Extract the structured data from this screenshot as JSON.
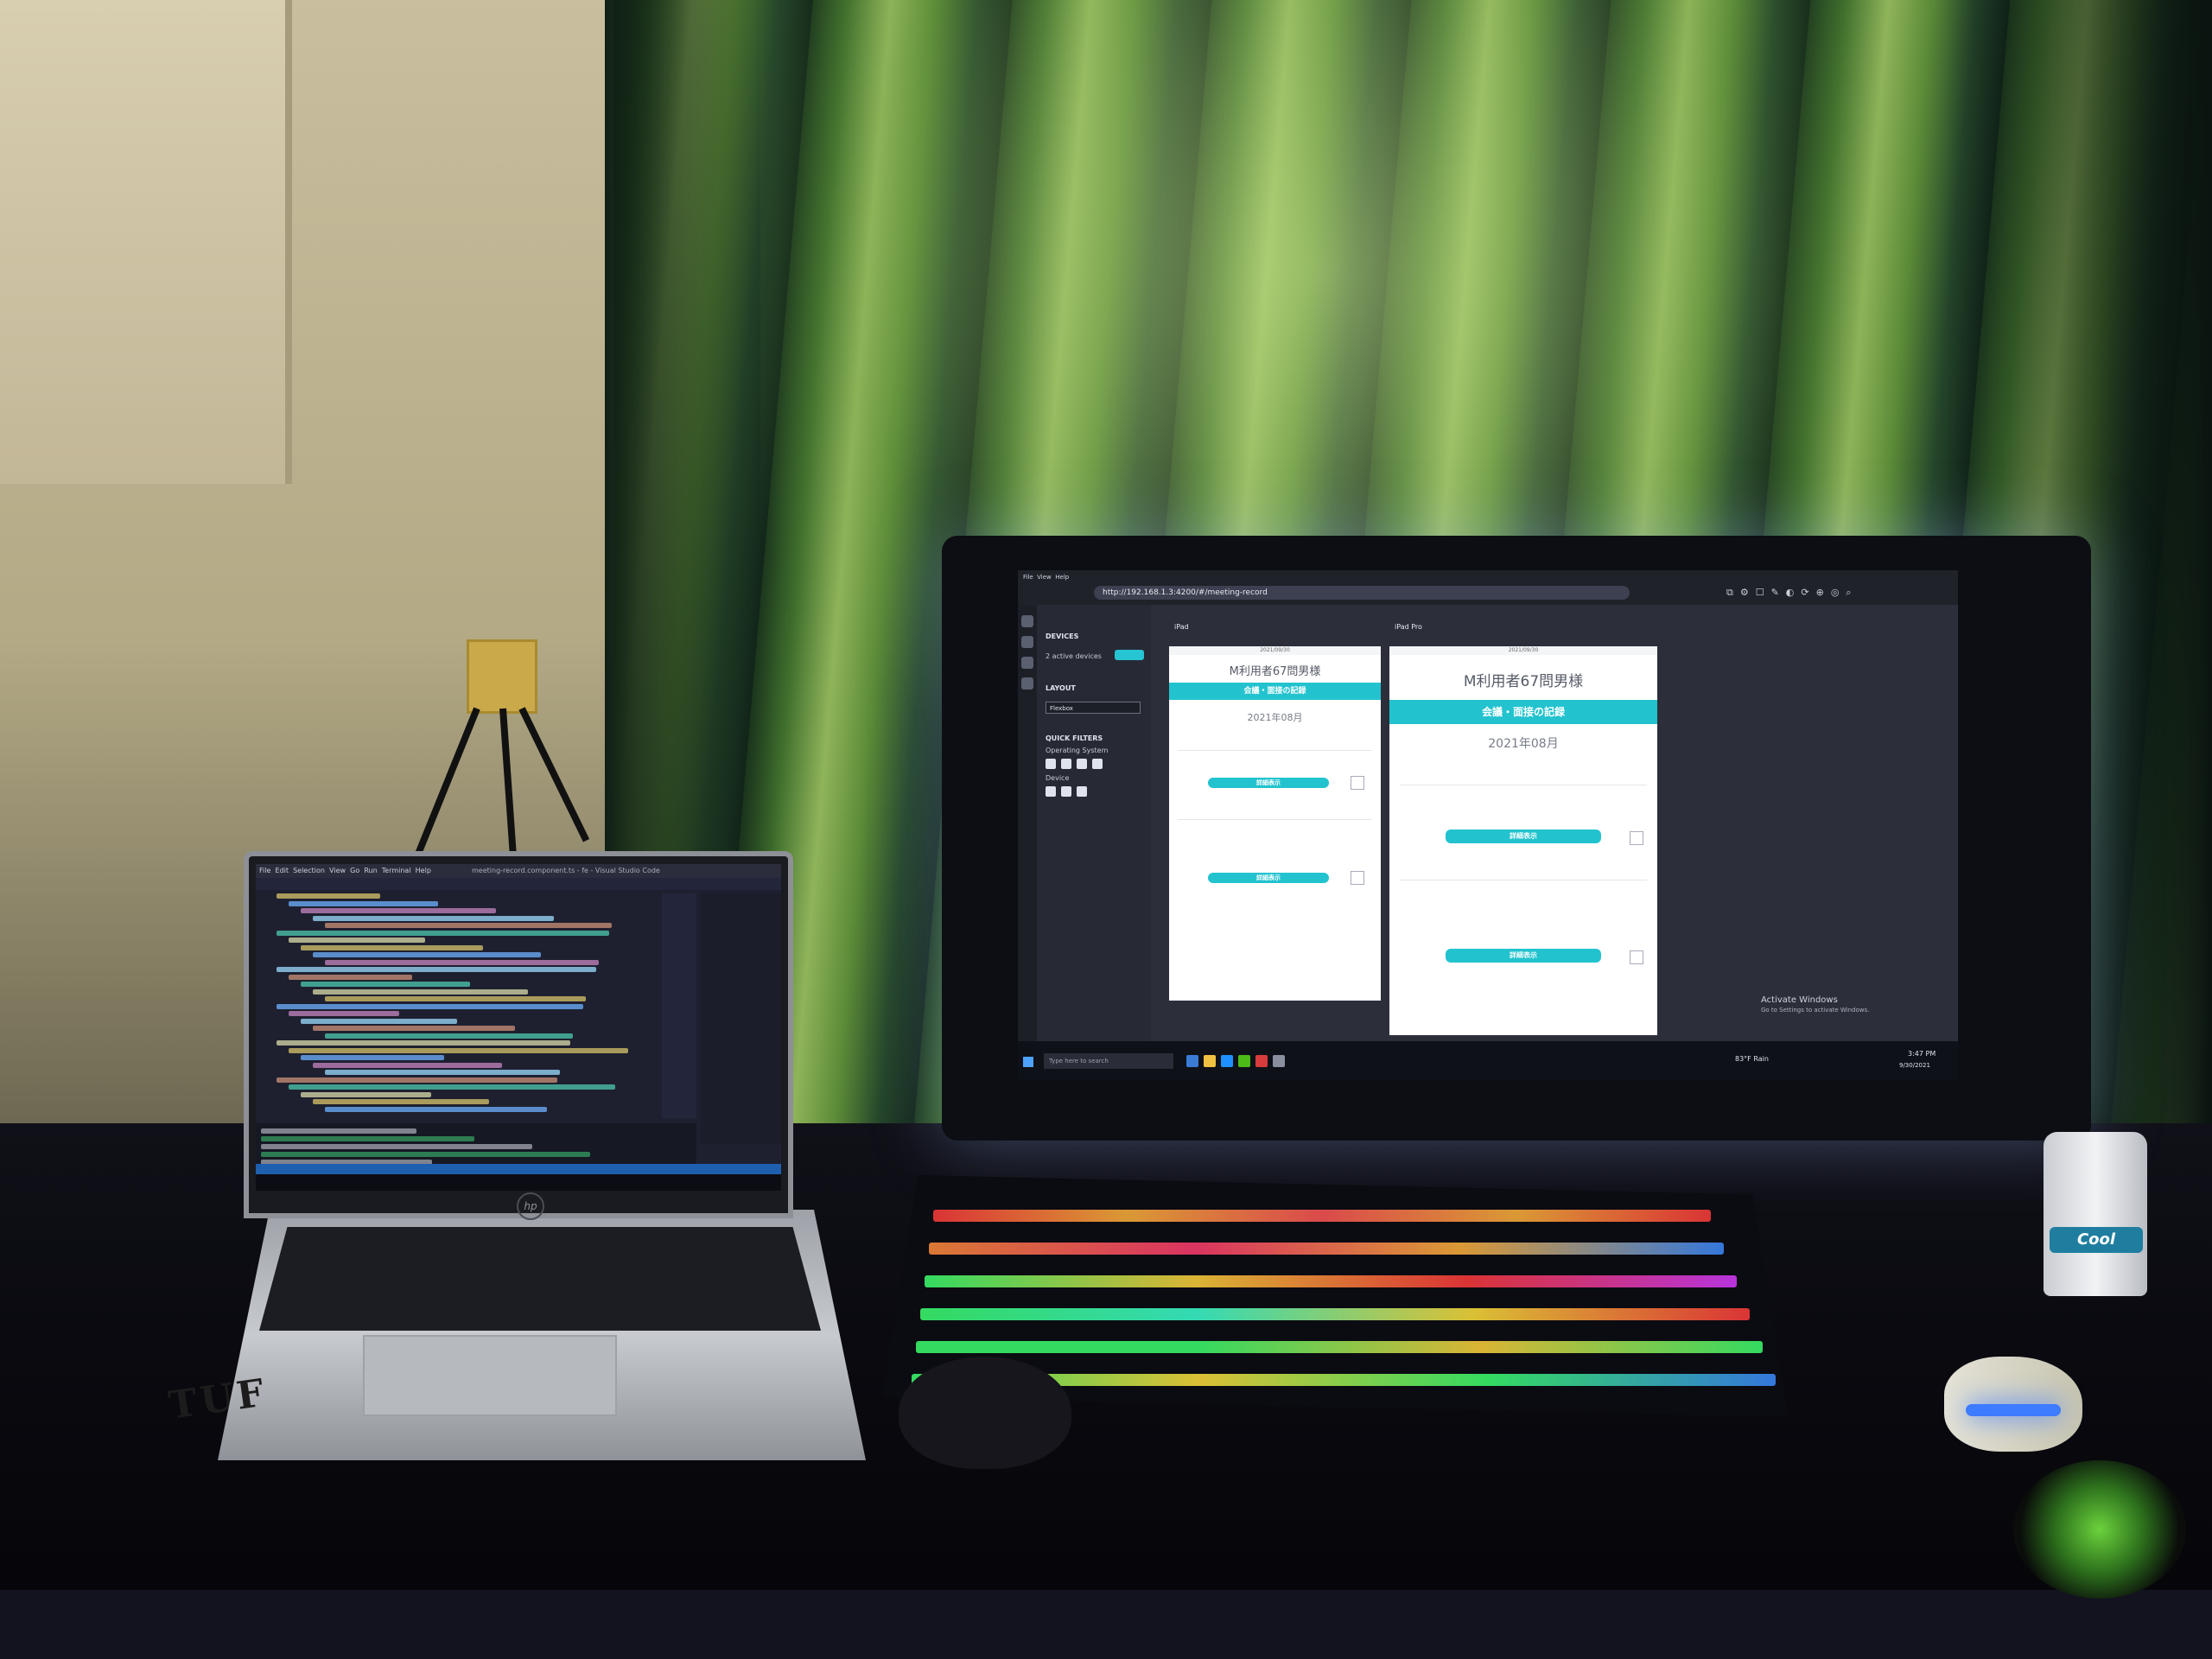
{
  "scene": {
    "description_colors": {
      "curtain": "#5b8a37",
      "accent_cyan": "#22c3cf",
      "monitor_glow": "#a0beff",
      "keyboard_backlight": [
        "#ff3b3b",
        "#ffb23b",
        "#3bff6e",
        "#3b8bff",
        "#d63bff"
      ]
    }
  },
  "laptop": {
    "brand_logo": "hp",
    "sticker_text": "TUF",
    "window_title": "meeting-record.component.ts - fe - Visual Studio Code",
    "menu": [
      "File",
      "Edit",
      "Selection",
      "View",
      "Go",
      "Run",
      "Terminal",
      "Help"
    ]
  },
  "monitor": {
    "browser": {
      "menu": [
        "File",
        "View",
        "Help"
      ],
      "url": "http://192.168.1.3:4200/#/meeting-record"
    },
    "side_panel": {
      "devices_heading": "DEVICES",
      "devices_count": "2 active devices",
      "layout_heading": "LAYOUT",
      "layout_value": "Flexbox",
      "quick_filters_heading": "QUICK FILTERS",
      "os_label": "Operating System",
      "device_label": "Device"
    },
    "devices": [
      {
        "name": "iPad",
        "date": "2021/09/30",
        "user_title": "M利用者67問男様",
        "banner": "会議・面接の記録",
        "month": "2021年08月",
        "button_label": "詳細表示"
      },
      {
        "name": "iPad Pro",
        "date": "2021/09/30",
        "user_title": "M利用者67問男様",
        "banner": "会議・面接の記録",
        "month": "2021年08月",
        "button_label": "詳細表示"
      }
    ],
    "activate_windows": {
      "title": "Activate Windows",
      "subtitle": "Go to Settings to activate Windows."
    },
    "taskbar": {
      "search_placeholder": "Type here to search",
      "weather": "83°F Rain",
      "time": "3:47 PM",
      "date": "9/30/2021"
    }
  },
  "peripherals": {
    "bottle_label": "Cool"
  }
}
